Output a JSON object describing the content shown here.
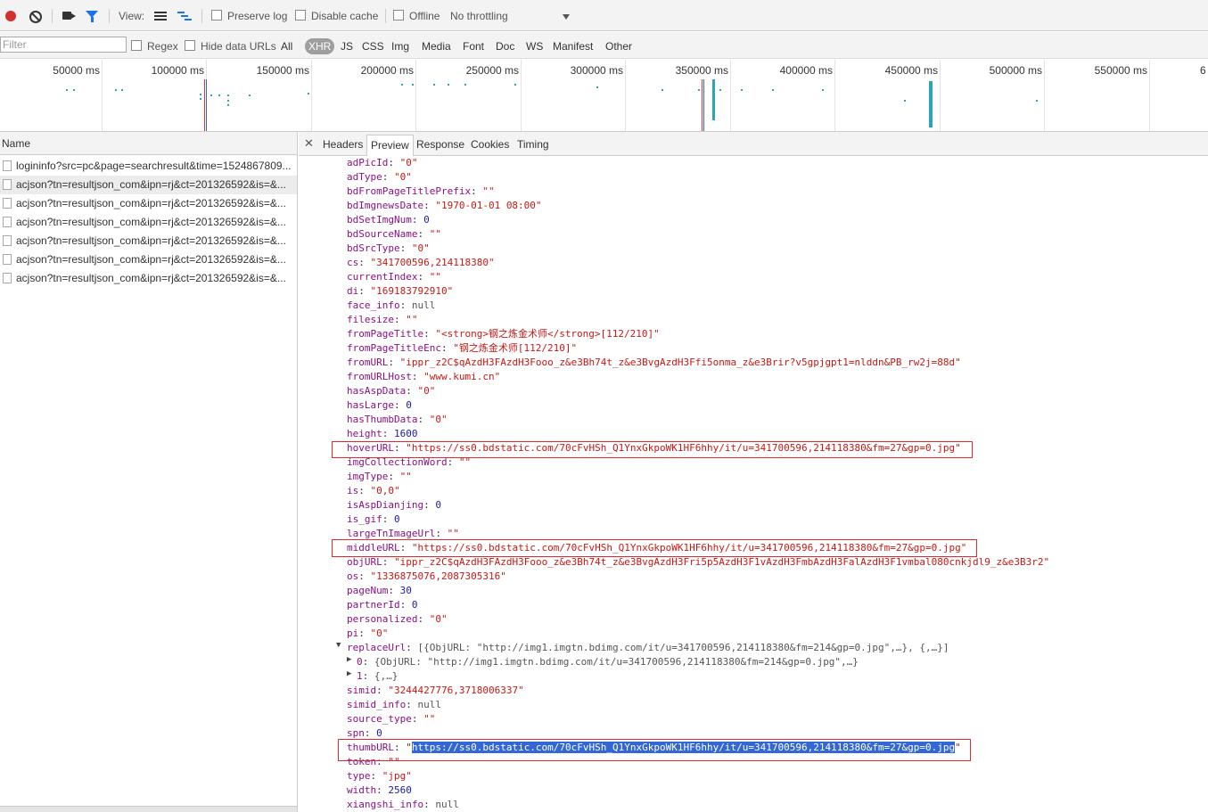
{
  "toolbar": {
    "view_label": "View:",
    "preserve_log": "Preserve log",
    "disable_cache": "Disable cache",
    "offline": "Offline",
    "throttling": "No throttling"
  },
  "filterbar": {
    "filter_placeholder": "Filter",
    "regex": "Regex",
    "hide_data_urls": "Hide data URLs",
    "types": [
      "All",
      "XHR",
      "JS",
      "CSS",
      "Img",
      "Media",
      "Font",
      "Doc",
      "WS",
      "Manifest",
      "Other"
    ],
    "active_type": "XHR"
  },
  "timeline": {
    "ticks": [
      "50000 ms",
      "100000 ms",
      "150000 ms",
      "200000 ms",
      "250000 ms",
      "300000 ms",
      "350000 ms",
      "400000 ms",
      "450000 ms",
      "500000 ms",
      "550000 ms",
      "6"
    ]
  },
  "requests": {
    "header": "Name",
    "rows": [
      "logininfo?src=pc&page=searchresult&time=1524867809...",
      "acjson?tn=resultjson_com&ipn=rj&ct=201326592&is=&...",
      "acjson?tn=resultjson_com&ipn=rj&ct=201326592&is=&...",
      "acjson?tn=resultjson_com&ipn=rj&ct=201326592&is=&...",
      "acjson?tn=resultjson_com&ipn=rj&ct=201326592&is=&...",
      "acjson?tn=resultjson_com&ipn=rj&ct=201326592&is=&...",
      "acjson?tn=resultjson_com&ipn=rj&ct=201326592&is=&..."
    ],
    "selected_index": 1
  },
  "detail_tabs": [
    "Headers",
    "Preview",
    "Response",
    "Cookies",
    "Timing"
  ],
  "active_tab": "Preview",
  "preview_lines": [
    {
      "key": "adPicId",
      "val": "\"0\"",
      "type": "s"
    },
    {
      "key": "adType",
      "val": "\"0\"",
      "type": "s"
    },
    {
      "key": "bdFromPageTitlePrefix",
      "val": "\"\"",
      "type": "s"
    },
    {
      "key": "bdImgnewsDate",
      "val": "\"1970-01-01 08:00\"",
      "type": "s"
    },
    {
      "key": "bdSetImgNum",
      "val": "0",
      "type": "n"
    },
    {
      "key": "bdSourceName",
      "val": "\"\"",
      "type": "s"
    },
    {
      "key": "bdSrcType",
      "val": "\"0\"",
      "type": "s"
    },
    {
      "key": "cs",
      "val": "\"341700596,214118380\"",
      "type": "s"
    },
    {
      "key": "currentIndex",
      "val": "\"\"",
      "type": "s"
    },
    {
      "key": "di",
      "val": "\"169183792910\"",
      "type": "s"
    },
    {
      "key": "face_info",
      "val": "null",
      "type": "g"
    },
    {
      "key": "filesize",
      "val": "\"\"",
      "type": "s"
    },
    {
      "key": "fromPageTitle",
      "val": "\"<strong>钢之炼金术师</strong>[112/210]\"",
      "type": "s"
    },
    {
      "key": "fromPageTitleEnc",
      "val": "\"钢之炼金术师[112/210]\"",
      "type": "s"
    },
    {
      "key": "fromURL",
      "val": "\"ippr_z2C$qAzdH3FAzdH3Fooo_z&e3Bh74t_z&e3BvgAzdH3Ffi5onma_z&e3Brir?v5gpjgpt1=nlddn&PB_rw2j=88d\"",
      "type": "s"
    },
    {
      "key": "fromURLHost",
      "val": "\"www.kumi.cn\"",
      "type": "s"
    },
    {
      "key": "hasAspData",
      "val": "\"0\"",
      "type": "s"
    },
    {
      "key": "hasLarge",
      "val": "0",
      "type": "n"
    },
    {
      "key": "hasThumbData",
      "val": "\"0\"",
      "type": "s"
    },
    {
      "key": "height",
      "val": "1600",
      "type": "n"
    },
    {
      "key": "hoverURL",
      "val": "\"https://ss0.bdstatic.com/70cFvHSh_Q1YnxGkpoWK1HF6hhy/it/u=341700596,214118380&fm=27&gp=0.jpg\"",
      "type": "s"
    },
    {
      "key": "imgCollectionWord",
      "val": "\"\"",
      "type": "s"
    },
    {
      "key": "imgType",
      "val": "\"\"",
      "type": "s"
    },
    {
      "key": "is",
      "val": "\"0,0\"",
      "type": "s"
    },
    {
      "key": "isAspDianjing",
      "val": "0",
      "type": "n"
    },
    {
      "key": "is_gif",
      "val": "0",
      "type": "n"
    },
    {
      "key": "largeTnImageUrl",
      "val": "\"\"",
      "type": "s"
    },
    {
      "key": "middleURL",
      "val": "\"https://ss0.bdstatic.com/70cFvHSh_Q1YnxGkpoWK1HF6hhy/it/u=341700596,214118380&fm=27&gp=0.jpg\"",
      "type": "s"
    },
    {
      "key": "objURL",
      "val": "\"ippr_z2C$qAzdH3FAzdH3Fooo_z&e3Bh74t_z&e3BvgAzdH3Fri5p5AzdH3F1vAzdH3FmbAzdH3FalAzdH3F1vmbal080cnkjdl9_z&e3B3r2\"",
      "type": "s"
    },
    {
      "key": "os",
      "val": "\"1336875076,2087305316\"",
      "type": "s"
    },
    {
      "key": "pageNum",
      "val": "30",
      "type": "n"
    },
    {
      "key": "partnerId",
      "val": "0",
      "type": "n"
    },
    {
      "key": "personalized",
      "val": "\"0\"",
      "type": "s"
    },
    {
      "key": "pi",
      "val": "\"0\"",
      "type": "s"
    },
    {
      "key": "replaceUrl",
      "val": "[{ObjURL: \"http://img1.imgtn.bdimg.com/it/u=341700596,214118380&fm=214&gp=0.jpg\",…}, {,…}]",
      "type": "g",
      "expanded": true
    },
    {
      "key": "0",
      "val": "{ObjURL: \"http://img1.imgtn.bdimg.com/it/u=341700596,214118380&fm=214&gp=0.jpg\",…}",
      "type": "g",
      "child": true
    },
    {
      "key": "1",
      "val": "{,…}",
      "type": "g",
      "child": true
    },
    {
      "key": "simid",
      "val": "\"3244427776,3718006337\"",
      "type": "s"
    },
    {
      "key": "simid_info",
      "val": "null",
      "type": "g"
    },
    {
      "key": "source_type",
      "val": "\"\"",
      "type": "s"
    },
    {
      "key": "spn",
      "val": "0",
      "type": "n"
    },
    {
      "key": "thumbURL",
      "val": "https://ss0.bdstatic.com/70cFvHSh_Q1YnxGkpoWK1HF6hhy/it/u=341700596,214118380&fm=27&gp=0.jpg",
      "type": "sel"
    },
    {
      "key": "token",
      "val": "\"\"",
      "type": "s"
    },
    {
      "key": "type",
      "val": "\"jpg\"",
      "type": "s"
    },
    {
      "key": "width",
      "val": "2560",
      "type": "n"
    },
    {
      "key": "xiangshi_info",
      "val": "null",
      "type": "g"
    }
  ],
  "colors": {
    "record": "#d32f2f",
    "key": "#881280",
    "string": "#c41a16",
    "number": "#1a1aa6",
    "annotation_box": "#e0292f",
    "selection": "#3367d6",
    "timeline_bar": "#2aa6b0"
  }
}
